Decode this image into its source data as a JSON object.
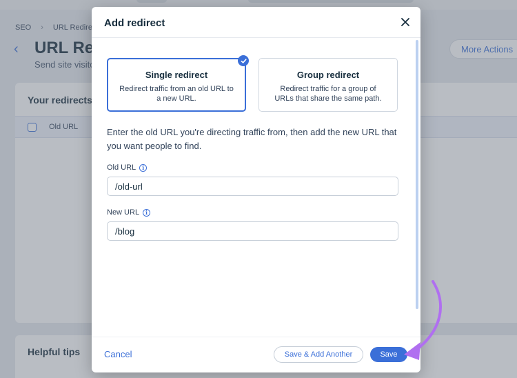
{
  "background": {
    "breadcrumb": [
      "SEO",
      "URL Redire"
    ],
    "page_title": "URL Red",
    "page_subtitle": "Send site visito",
    "more_actions_label": "More Actions",
    "redirects_card_title": "Your redirects",
    "column_old_url": "Old URL",
    "tips_card_title": "Helpful tips"
  },
  "modal": {
    "title": "Add redirect",
    "options": [
      {
        "title": "Single redirect",
        "description": "Redirect traffic from an old URL to a new URL.",
        "selected": true
      },
      {
        "title": "Group redirect",
        "description": "Redirect traffic for a group of URLs that share the same path.",
        "selected": false
      }
    ],
    "instructions": "Enter the old URL you're directing traffic from, then add the new URL that you want people to find.",
    "old_url": {
      "label": "Old URL",
      "value": "/old-url"
    },
    "new_url": {
      "label": "New URL",
      "value": "/blog"
    },
    "footer": {
      "cancel_label": "Cancel",
      "save_another_label": "Save & Add Another",
      "save_label": "Save"
    }
  },
  "icons": {
    "close": "close-icon",
    "check": "checkmark-icon",
    "info": "info-icon",
    "back": "back-arrow-icon",
    "annotation": "curved-arrow-annotation"
  },
  "colors": {
    "accent": "#3b6fd8",
    "text": "#162d3d",
    "annotation": "#b06ff0"
  }
}
